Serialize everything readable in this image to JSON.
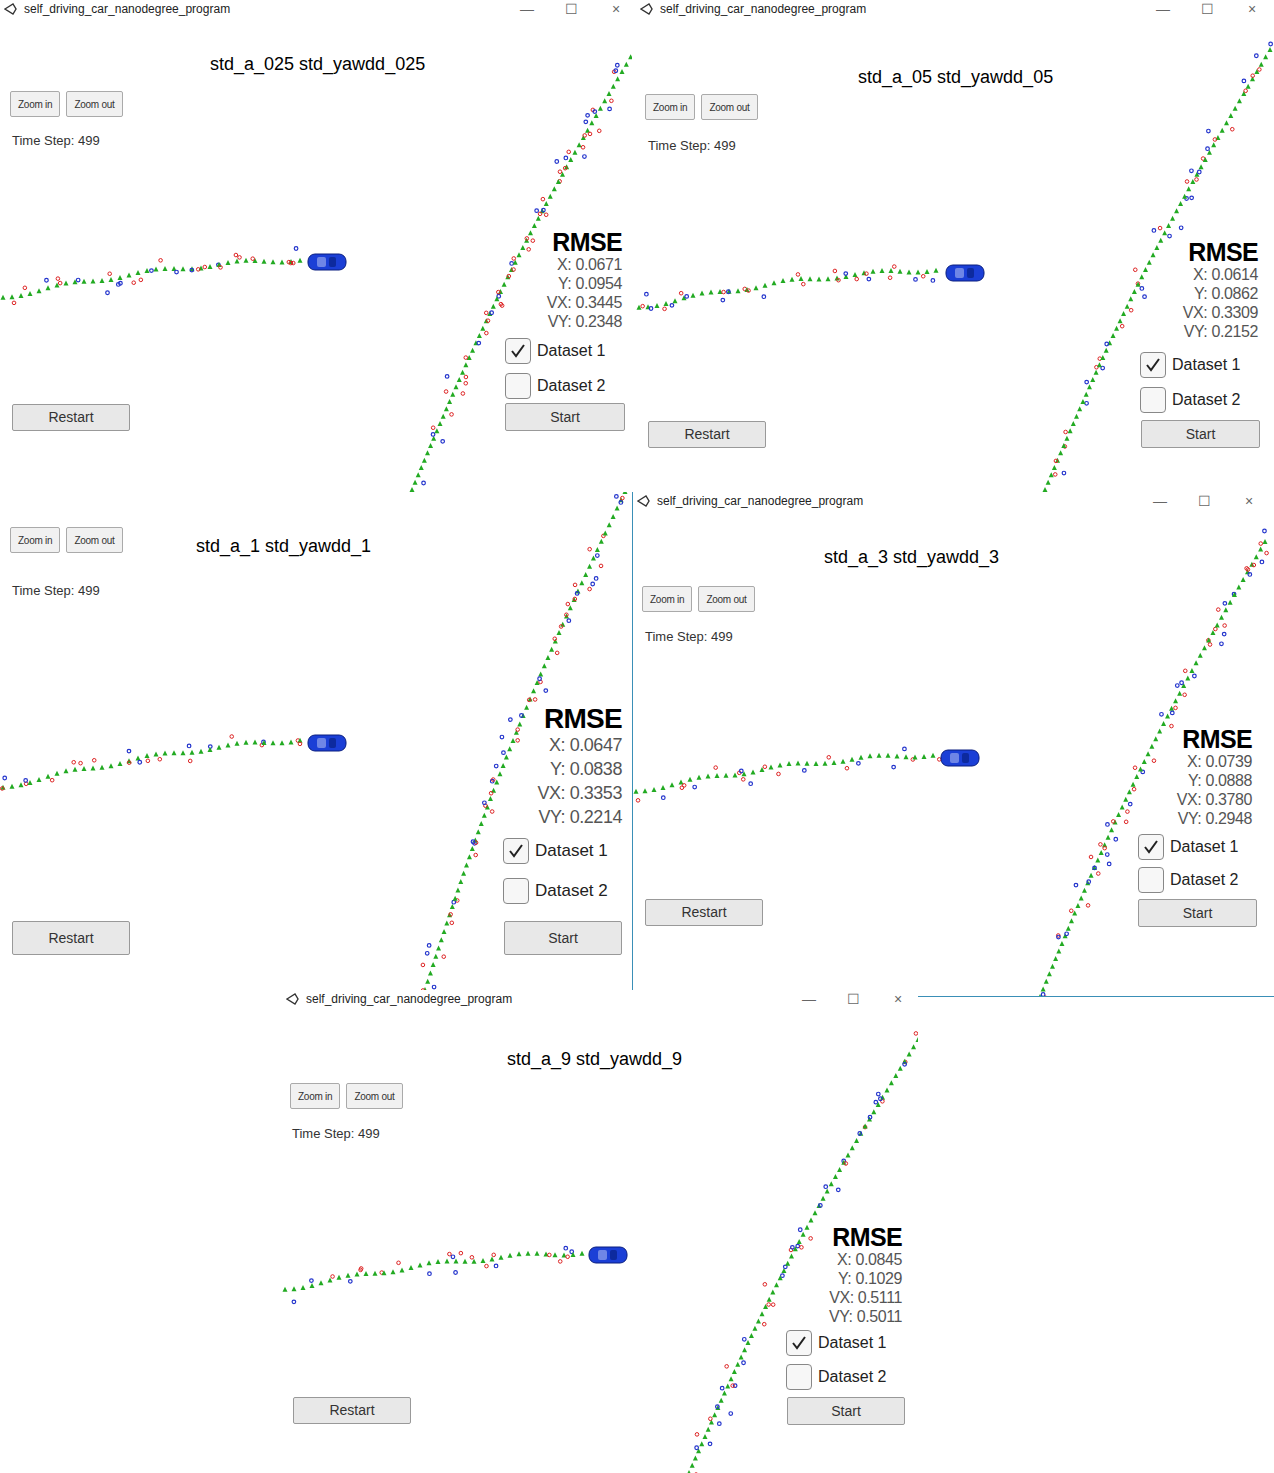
{
  "panels": [
    {
      "window_title": "self_driving_car_nanodegree_program",
      "controls": [
        "—",
        "☐",
        "×"
      ],
      "label": "std_a_025 std_yawdd_025",
      "zoom_in": "Zoom in",
      "zoom_out": "Zoom out",
      "time_step": "Time Step: 499",
      "rmse_title": "RMSE",
      "rmse": [
        "X: 0.0671",
        "Y: 0.0954",
        "VX: 0.3445",
        "VY: 0.2348"
      ],
      "datasets": [
        {
          "label": "Dataset 1",
          "checked": true
        },
        {
          "label": "Dataset 2",
          "checked": false
        }
      ],
      "start": "Start",
      "restart": "Restart"
    },
    {
      "window_title": "self_driving_car_nanodegree_program",
      "controls": [
        "—",
        "☐",
        "×"
      ],
      "label": "std_a_05 std_yawdd_05",
      "zoom_in": "Zoom in",
      "zoom_out": "Zoom out",
      "time_step": "Time Step: 499",
      "rmse_title": "RMSE",
      "rmse": [
        "X: 0.0614",
        "Y: 0.0862",
        "VX: 0.3309",
        "VY: 0.2152"
      ],
      "datasets": [
        {
          "label": "Dataset 1",
          "checked": true
        },
        {
          "label": "Dataset 2",
          "checked": false
        }
      ],
      "start": "Start",
      "restart": "Restart"
    },
    {
      "window_title": null,
      "controls": [],
      "label": "std_a_1 std_yawdd_1",
      "zoom_in": "Zoom in",
      "zoom_out": "Zoom out",
      "time_step": "Time Step: 499",
      "rmse_title": "RMSE",
      "rmse": [
        "X: 0.0647",
        "Y: 0.0838",
        "VX: 0.3353",
        "VY: 0.2214"
      ],
      "datasets": [
        {
          "label": "Dataset 1",
          "checked": true
        },
        {
          "label": "Dataset 2",
          "checked": false
        }
      ],
      "start": "Start",
      "restart": "Restart"
    },
    {
      "window_title": "self_driving_car_nanodegree_program",
      "controls": [
        "—",
        "☐",
        "×"
      ],
      "label": "std_a_3 std_yawdd_3",
      "zoom_in": "Zoom in",
      "zoom_out": "Zoom out",
      "time_step": "Time Step: 499",
      "rmse_title": "RMSE",
      "rmse": [
        "X: 0.0739",
        "Y: 0.0888",
        "VX: 0.3780",
        "VY: 0.2948"
      ],
      "datasets": [
        {
          "label": "Dataset 1",
          "checked": true
        },
        {
          "label": "Dataset 2",
          "checked": false
        }
      ],
      "start": "Start",
      "restart": "Restart"
    },
    {
      "window_title": "self_driving_car_nanodegree_program",
      "controls": [
        "—",
        "☐",
        "×"
      ],
      "label": "std_a_9 std_yawdd_9",
      "zoom_in": "Zoom in",
      "zoom_out": "Zoom out",
      "time_step": "Time Step: 499",
      "rmse_title": "RMSE",
      "rmse": [
        "X: 0.0845",
        "Y: 0.1029",
        "VX: 0.5111",
        "VY: 0.5011"
      ],
      "datasets": [
        {
          "label": "Dataset 1",
          "checked": true
        },
        {
          "label": "Dataset 2",
          "checked": false
        }
      ],
      "start": "Start",
      "restart": "Restart"
    }
  ]
}
